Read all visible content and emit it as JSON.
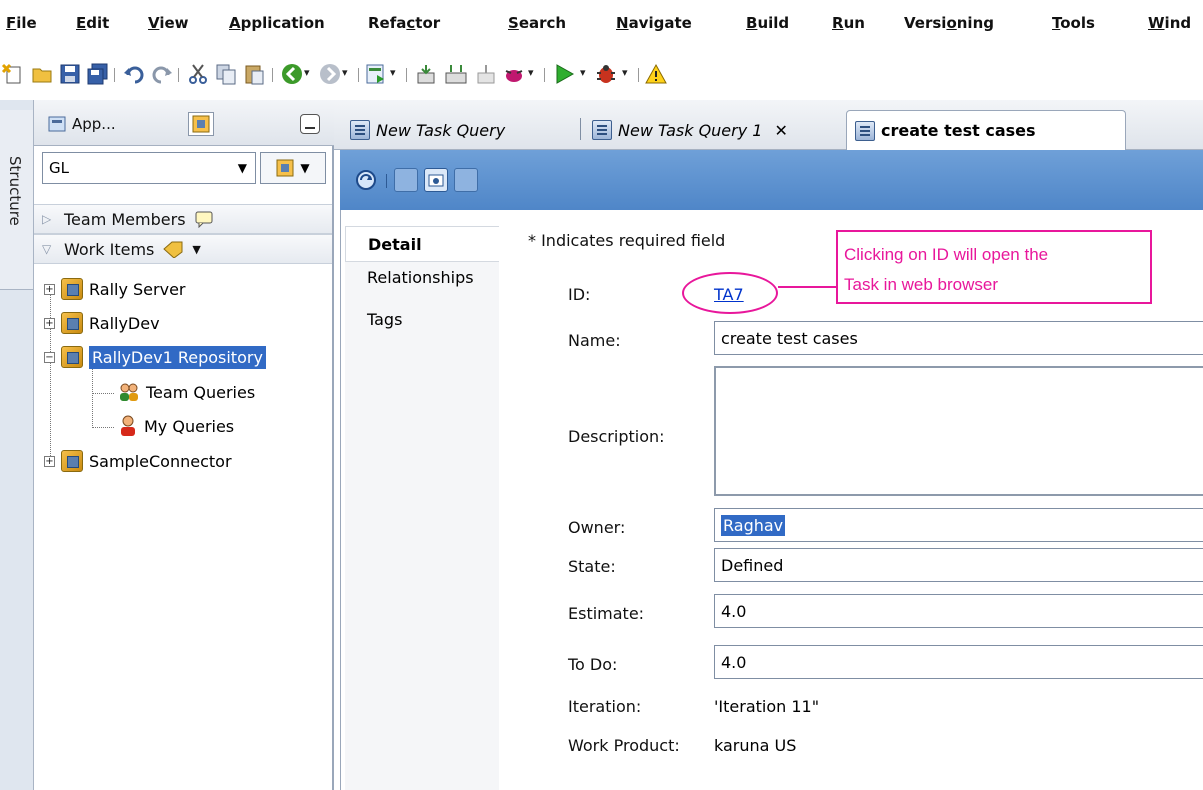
{
  "menu": {
    "items": [
      {
        "pre": "",
        "u": "F",
        "post": "ile"
      },
      {
        "pre": "",
        "u": "E",
        "post": "dit"
      },
      {
        "pre": "",
        "u": "V",
        "post": "iew"
      },
      {
        "pre": "",
        "u": "A",
        "post": "pplication"
      },
      {
        "pre": "Refa",
        "u": "c",
        "post": "tor"
      },
      {
        "pre": "",
        "u": "S",
        "post": "earch"
      },
      {
        "pre": "",
        "u": "N",
        "post": "avigate"
      },
      {
        "pre": "",
        "u": "B",
        "post": "uild"
      },
      {
        "pre": "",
        "u": "R",
        "post": "un"
      },
      {
        "pre": "Versi",
        "u": "o",
        "post": "ning"
      },
      {
        "pre": "",
        "u": "T",
        "post": "ools"
      },
      {
        "pre": "",
        "u": "W",
        "post": "ind"
      }
    ]
  },
  "left_strip": {
    "label": "Structure"
  },
  "navigator": {
    "tab_app": "App...",
    "app_combo_value": "GL",
    "team_members_label": "Team Members",
    "work_items_label": "Work Items",
    "tree": {
      "rally_server": "Rally Server",
      "rallydev": "RallyDev",
      "rallydev1": "RallyDev1 Repository",
      "team_queries": "Team Queries",
      "my_queries": "My Queries",
      "sample_connector": "SampleConnector"
    }
  },
  "editor_tabs": {
    "tab1": "New Task Query",
    "tab2": "New Task Query 1",
    "tab3": "create test cases",
    "close_glyph": "✕"
  },
  "side_tabs": {
    "detail": "Detail",
    "relationships": "Relationships",
    "tags": "Tags"
  },
  "form": {
    "required_note": "* Indicates required field",
    "id_label": "ID:",
    "id_value": "TA7",
    "name_label": "Name:",
    "name_value": "create test cases",
    "description_label": "Description:",
    "owner_label": "Owner:",
    "owner_value": "Raghav",
    "state_label": "State:",
    "state_value": "Defined",
    "estimate_label": "Estimate:",
    "estimate_value": "4.0",
    "todo_label": "To Do:",
    "todo_value": "4.0",
    "iteration_label": "Iteration:",
    "iteration_value": "'Iteration 11\"",
    "work_product_label": "Work Product:",
    "work_product_value": "karuna US"
  },
  "annotation": {
    "line1": "Clicking on ID will open the",
    "line2": "Task in web browser",
    "color": "#e8179b"
  }
}
